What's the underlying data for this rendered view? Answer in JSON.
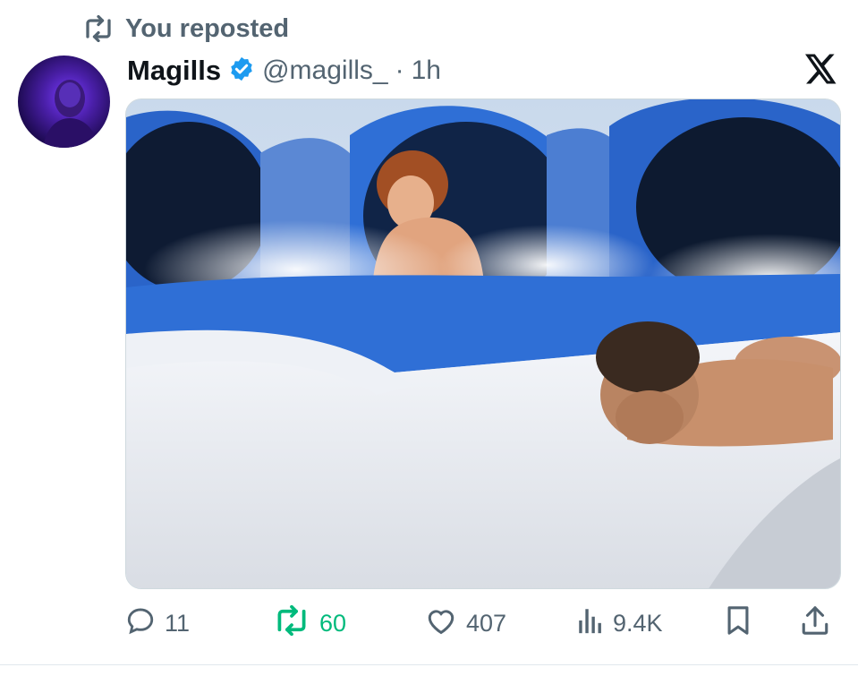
{
  "repost_banner": {
    "label": "You reposted",
    "icon": "repost-icon"
  },
  "author": {
    "display_name": "Magills",
    "verified": true,
    "handle": "@magills_",
    "separator": "·",
    "time": "1h",
    "verified_color": "#1d9bf0"
  },
  "platform_logo": "x-logo-icon",
  "actions": {
    "reply": {
      "count": "11",
      "icon": "reply-icon"
    },
    "repost": {
      "count": "60",
      "icon": "repost-icon",
      "active_color": "#00ba7c"
    },
    "like": {
      "count": "407",
      "icon": "heart-icon"
    },
    "views": {
      "count": "9.4K",
      "icon": "views-icon"
    },
    "bookmark": {
      "icon": "bookmark-icon"
    },
    "share": {
      "icon": "share-icon"
    }
  },
  "colors": {
    "text_secondary": "#536471",
    "text_primary": "#0f1419",
    "slide_blue": "#2f6fd6"
  }
}
